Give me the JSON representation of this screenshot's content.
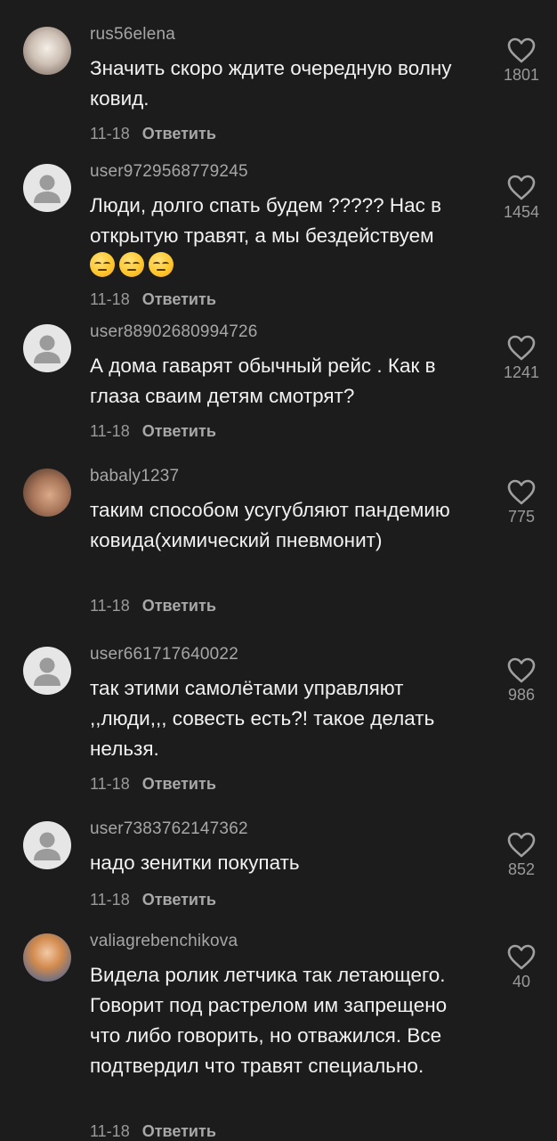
{
  "reply_label": "Ответить",
  "comments": [
    {
      "username": "rus56elena",
      "text": "Значить скоро ждите очередную волну ковид.",
      "date": "11-18",
      "likes": "1801",
      "avatar": "photo"
    },
    {
      "username": "user9729568779245",
      "text": "Люди, долго спать будем ????? Нас в открытую травят, а мы бездействуем",
      "emoji": [
        "pensive-face",
        "pensive-face",
        "pensive-face"
      ],
      "date": "11-18",
      "likes": "1454",
      "avatar": "default"
    },
    {
      "username": "user88902680994726",
      "text": "А дома гаварят обычный рейс . Как в глаза сваим детям смотрят?",
      "date": "11-18",
      "likes": "1241",
      "avatar": "default"
    },
    {
      "username": "babaly1237",
      "text": "таким способом усугубляют пандемию ковида(химический пневмонит)",
      "date": "11-18",
      "likes": "775",
      "avatar": "photo"
    },
    {
      "username": "user661717640022",
      "text": "так этими самолётами управляют ,,люди,,, совесть есть?! такое делать нельзя.",
      "date": "11-18",
      "likes": "986",
      "avatar": "default"
    },
    {
      "username": "user7383762147362",
      "text": "надо зенитки покупать",
      "date": "11-18",
      "likes": "852",
      "avatar": "default"
    },
    {
      "username": "valiagrebenchikova",
      "text": "Видела ролик летчика так летающего. Говорит под растрелом им запрещено что либо говорить, но отважился. Все подтвердил что травят специально.",
      "date": "11-18",
      "likes": "40",
      "avatar": "photo"
    }
  ],
  "colors": {
    "background": "#1c1c1c",
    "text": "#f2f2f2",
    "muted": "#9a9a9a"
  }
}
